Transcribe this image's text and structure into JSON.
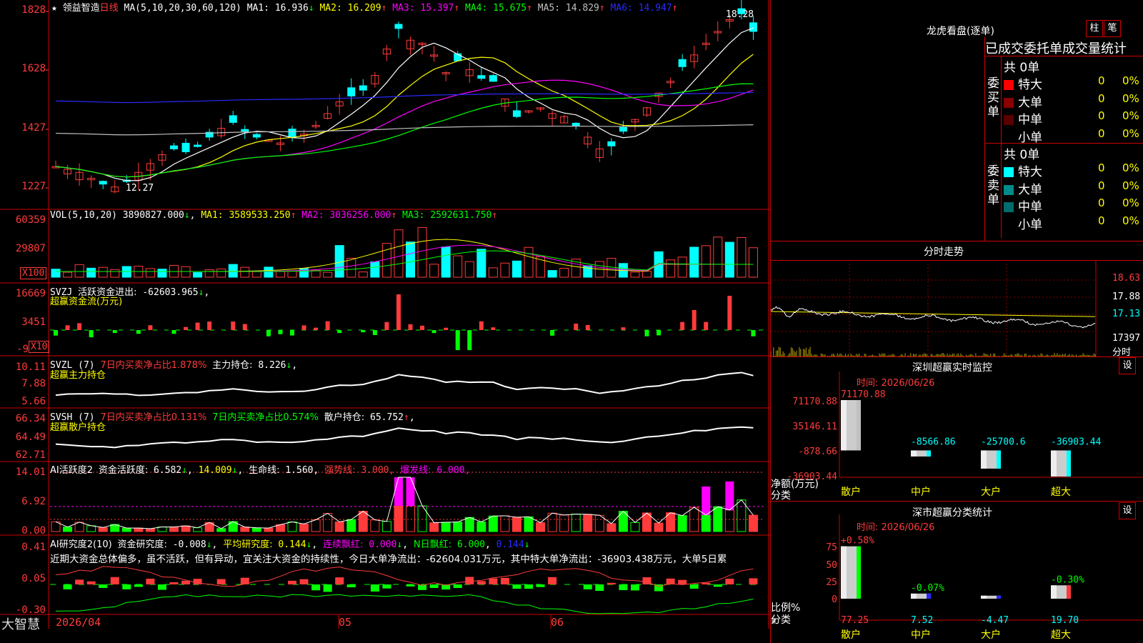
{
  "stock": {
    "name": "领益智造",
    "period": "日线"
  },
  "price_panel": {
    "ma_header": "MA(5,10,20,30,60,120)",
    "ma": [
      {
        "label": "MA1:",
        "value": "16.936",
        "arrow": "↓",
        "color": "#ffffff"
      },
      {
        "label": "MA2:",
        "value": "16.209",
        "arrow": "↑",
        "color": "#ffff00"
      },
      {
        "label": "MA3:",
        "value": "15.397",
        "arrow": "↑",
        "color": "#ff00ff"
      },
      {
        "label": "MA4:",
        "value": "15.675",
        "arrow": "↑",
        "color": "#00ff00"
      },
      {
        "label": "MA5:",
        "value": "14.829",
        "arrow": "↑",
        "color": "#c0c0c0"
      },
      {
        "label": "MA6:",
        "value": "14.947",
        "arrow": "↑",
        "color": "#2a2aff"
      }
    ],
    "y_ticks": [
      "1828",
      "1628",
      "1427",
      "1227"
    ],
    "high_label": "18.28",
    "low_label": "12.27"
  },
  "vol_panel": {
    "header": "VOL(5,10,20)",
    "value": "3890827.000",
    "ma": [
      {
        "label": "MA1:",
        "value": "3589533.250",
        "arrow": "↑",
        "color": "#ffff00"
      },
      {
        "label": "MA2:",
        "value": "3036256.000",
        "arrow": "↑",
        "color": "#ff00ff"
      },
      {
        "label": "MA3:",
        "value": "2592631.750",
        "arrow": "↑",
        "color": "#00ff00"
      }
    ],
    "y_ticks": [
      "60359",
      "29807"
    ],
    "unit": "X100"
  },
  "svzj_panel": {
    "header": "SVZJ",
    "label": "活跃资金进出:",
    "value": "-62603.965",
    "sub": "超赢资金流(万元)",
    "y_ticks": [
      "16669",
      "3451",
      "-9"
    ],
    "unit": "X10"
  },
  "svzl_panel": {
    "header": "SVZL (7)",
    "label1": "7日内买卖净占比1.878%",
    "label2": "主力持仓:",
    "value": "8.226",
    "sub": "超赢主力持仓",
    "y_ticks": [
      "10.11",
      "7.88",
      "5.66"
    ]
  },
  "svsh_panel": {
    "header": "SVSH (7)",
    "label1": "7日内买卖净占比0.131%",
    "label2": "7日内买卖净占比0.574%",
    "label3": "散户持仓:",
    "value": "65.752",
    "sub": "超赢散户持仓",
    "y_ticks": [
      "66.34",
      "64.49",
      "62.71"
    ]
  },
  "ai_active_panel": {
    "header": "AI活跃度2",
    "label": "资金活跃度:",
    "v1": "6.582",
    "v2": "14.009",
    "life_label": "生命线:",
    "life": "1.560",
    "strong_label": "强势线:",
    "strong": "3.000",
    "burst_label": "爆发线:",
    "burst": "6.000",
    "y_ticks": [
      "14.01",
      "6.92",
      "0.00"
    ]
  },
  "ai_research_panel": {
    "header": "AI研究度2(10)",
    "label": "资金研究度:",
    "v1": "-0.008",
    "avg_label": "平均研究度:",
    "avg": "0.144",
    "red_label": "连续飘红:",
    "red": "0.000",
    "n_label": "N日飘红:",
    "n": "6.000",
    "n2": "0.144",
    "comment": "近期大资金总体偏多，虽不活跃，但有异动，宜关注大资金的持续性，今日大单净流出：-62604.031万元，其中特大单净流出：-36903.438万元，大单5日累",
    "y_ticks": [
      "0.41",
      "0.05",
      "-0.30"
    ]
  },
  "date_axis": {
    "brand": "大智慧",
    "labels": [
      "2026/04",
      "05",
      "06"
    ]
  },
  "dragon_tiger": {
    "title": "龙虎看盘(逐单)",
    "btn_bar": "柱",
    "btn_pen": "笔",
    "tabs_header": "已成交委托单成交量统计",
    "buy": {
      "side": "委买单",
      "count": "共 0单",
      "rows": [
        {
          "name": "特大",
          "num": "0",
          "pct": "0%",
          "color": "#ff0000"
        },
        {
          "name": "大单",
          "num": "0",
          "pct": "0%",
          "color": "#8b0000"
        },
        {
          "name": "中单",
          "num": "0",
          "pct": "0%",
          "color": "#5a0000"
        },
        {
          "name": "小单",
          "num": "0",
          "pct": "0%",
          "color": ""
        }
      ]
    },
    "sell": {
      "side": "委卖单",
      "count": "共 0单",
      "rows": [
        {
          "name": "特大",
          "num": "0",
          "pct": "0%",
          "color": "#00ffff"
        },
        {
          "name": "大单",
          "num": "0",
          "pct": "0%",
          "color": "#008b8b"
        },
        {
          "name": "中单",
          "num": "0",
          "pct": "0%",
          "color": "#006b6b"
        },
        {
          "name": "小单",
          "num": "0",
          "pct": "0%",
          "color": ""
        }
      ]
    }
  },
  "intraday": {
    "title": "分时走势",
    "ticks": [
      "18.63",
      "17.88",
      "17.13",
      "17397"
    ],
    "corner": "分时"
  },
  "sz_monitor": {
    "title": "深圳超赢实时监控",
    "set": "设",
    "time": "时间: 2026/06/26",
    "y_ticks": [
      "71170.88",
      "35146.11",
      "-878.66",
      "-36903.44"
    ],
    "ylabel1": "净额(万元)",
    "ylabel2": "分类",
    "chart_data": {
      "type": "bar",
      "categories": [
        "散户",
        "中户",
        "大户",
        "超大"
      ],
      "values": [
        71170.88,
        -8566.86,
        -25700.6,
        -36903.44
      ],
      "ylim": [
        -36903.44,
        71170.88
      ]
    },
    "value_labels": [
      "71170.88",
      "-8566.86",
      "-25700.6",
      "-36903.44"
    ]
  },
  "sz_class": {
    "title": "深市超赢分类统计",
    "set": "设",
    "time": "时间: 2026/06/26",
    "y_ticks": [
      "75",
      "50",
      "25",
      "0"
    ],
    "ylabel1": "比例%",
    "ylabel2": "分类",
    "chart_data": {
      "type": "bar",
      "categories": [
        "散户",
        "中户",
        "大户",
        "超大"
      ],
      "values": [
        77.25,
        7.52,
        -4.47,
        19.7
      ],
      "changes": [
        "+0.58%",
        "-0.07%",
        "",
        "-0.30%"
      ],
      "ylim": [
        0,
        80
      ]
    },
    "value_labels": [
      "77.25",
      "7.52",
      "-4.47",
      "19.70"
    ]
  }
}
